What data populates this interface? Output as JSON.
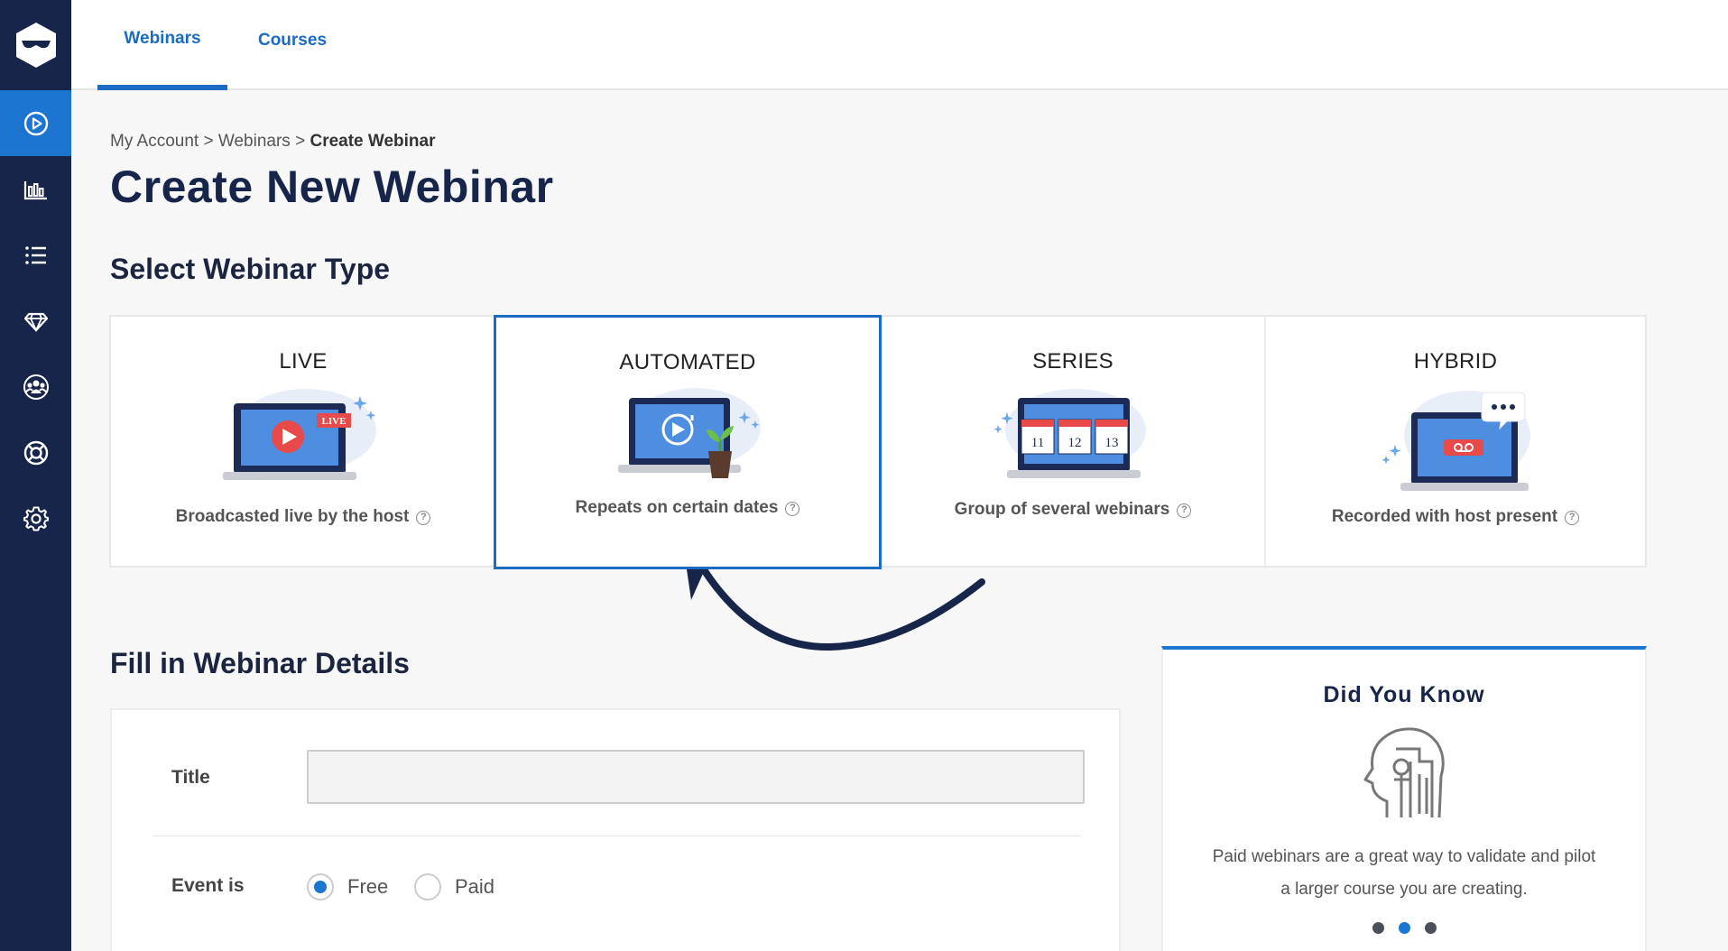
{
  "tabs": [
    {
      "label": "Webinars",
      "active": true
    },
    {
      "label": "Courses",
      "active": false
    }
  ],
  "sidebar": {
    "items": [
      {
        "icon": "play-circle-icon",
        "active": true
      },
      {
        "icon": "bar-chart-icon",
        "active": false
      },
      {
        "icon": "list-icon",
        "active": false
      },
      {
        "icon": "gem-icon",
        "active": false
      },
      {
        "icon": "users-icon",
        "active": false
      },
      {
        "icon": "lifebuoy-icon",
        "active": false
      },
      {
        "icon": "gear-icon",
        "active": false
      }
    ]
  },
  "breadcrumb": {
    "items": [
      "My Account",
      "Webinars"
    ],
    "separator": ">",
    "current": "Create Webinar"
  },
  "page_title": "Create New Webinar",
  "select_type": {
    "heading": "Select Webinar Type",
    "selected": "AUTOMATED",
    "types": [
      {
        "title": "LIVE",
        "description": "Broadcasted live by the host",
        "badge": "LIVE"
      },
      {
        "title": "AUTOMATED",
        "description": "Repeats on certain dates"
      },
      {
        "title": "SERIES",
        "description": "Group of several webinars",
        "dates": [
          "11",
          "12",
          "13"
        ]
      },
      {
        "title": "HYBRID",
        "description": "Recorded with host present"
      }
    ]
  },
  "details": {
    "heading": "Fill in Webinar Details",
    "title_label": "Title",
    "title_value": "",
    "event_label": "Event is",
    "options": [
      "Free",
      "Paid"
    ],
    "selected_option": "Free"
  },
  "did_you_know": {
    "title": "Did You Know",
    "text_line1": "Paid webinars are a great way to validate and pilot",
    "text_line2": "a larger course you are creating.",
    "active_dot": 2
  },
  "colors": {
    "sidebar": "#18254a",
    "accent": "#1b75d1",
    "tab_text": "#1b6bc2"
  }
}
